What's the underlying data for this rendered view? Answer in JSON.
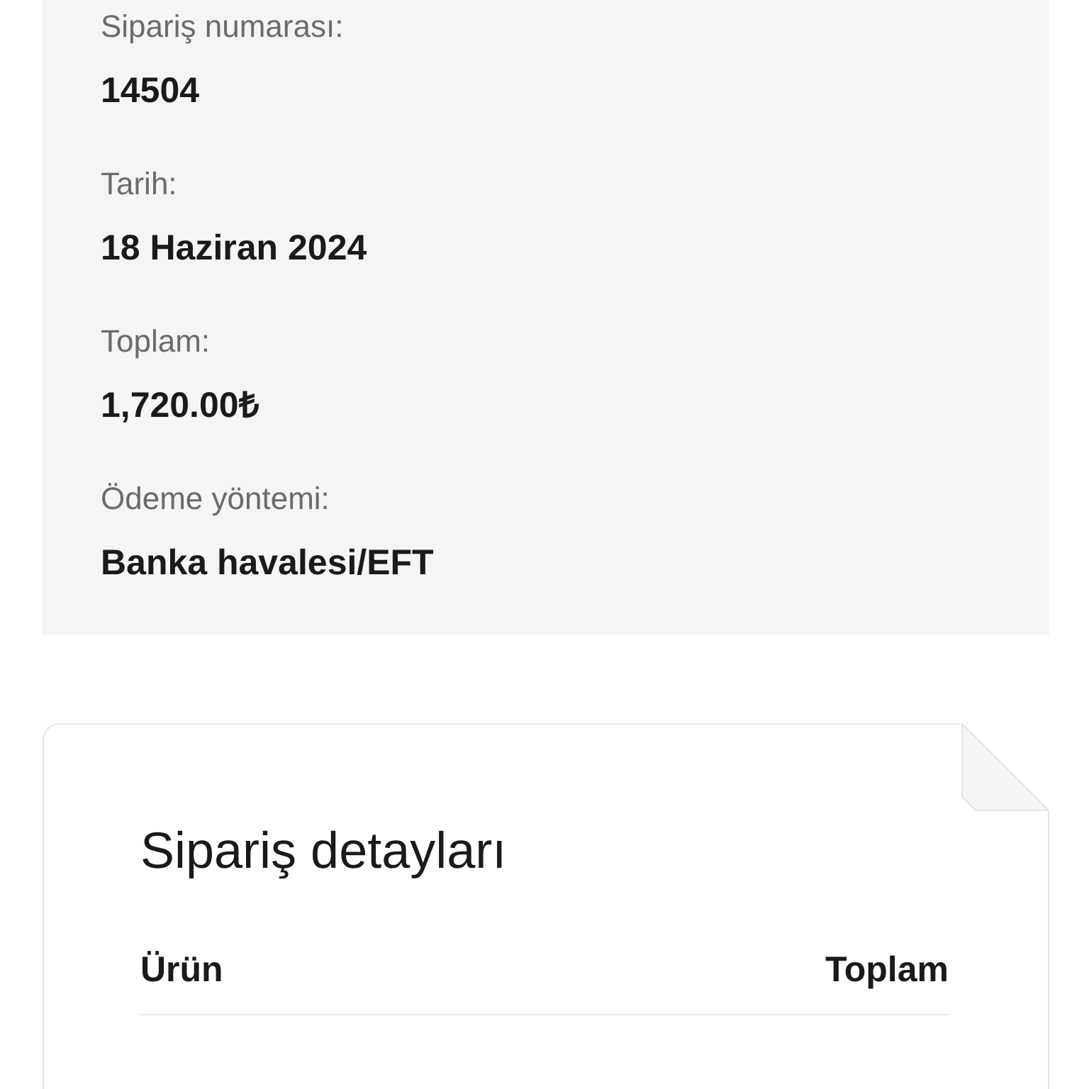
{
  "order_summary": [
    {
      "label": "Sipariş numarası:",
      "value": "14504"
    },
    {
      "label": "Tarih:",
      "value": "18 Haziran 2024"
    },
    {
      "label": "Toplam:",
      "value": "1,720.00₺"
    },
    {
      "label": "Ödeme yöntemi:",
      "value": "Banka havalesi/EFT"
    }
  ],
  "order_details": {
    "title": "Sipariş detayları",
    "columns": [
      "Ürün",
      "Toplam"
    ]
  }
}
